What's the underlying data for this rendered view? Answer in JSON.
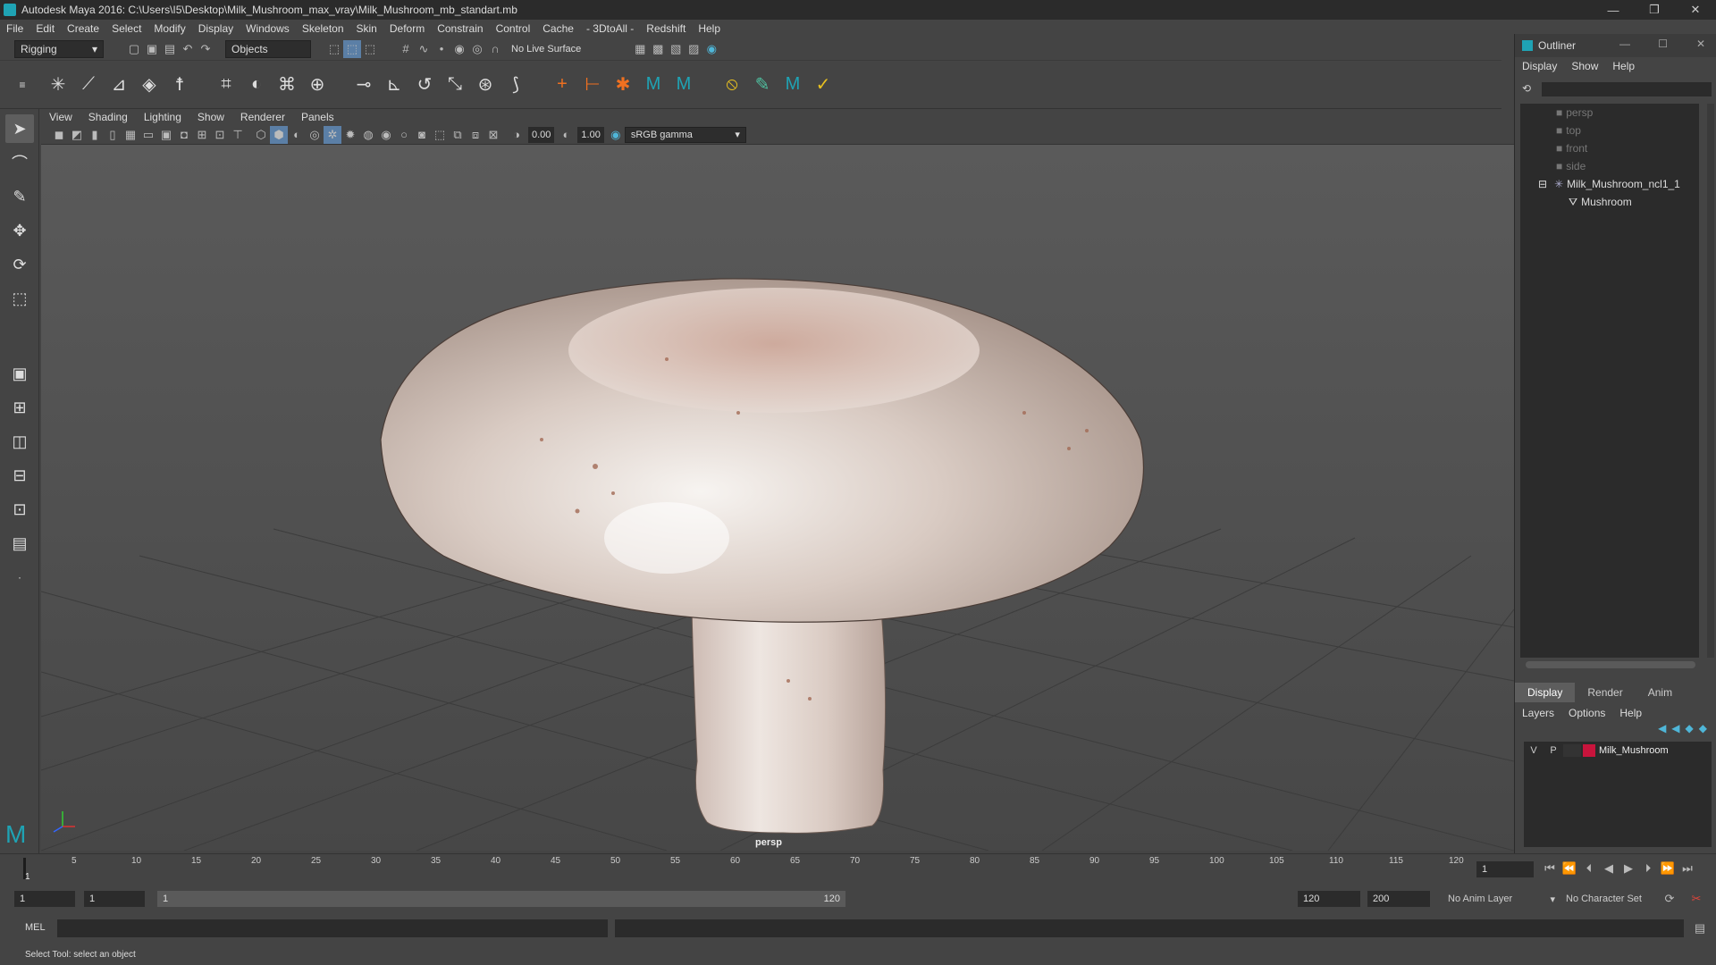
{
  "window": {
    "title": "Autodesk Maya 2016: C:\\Users\\I5\\Desktop\\Milk_Mushroom_max_vray\\Milk_Mushroom_mb_standart.mb",
    "minimize": "—",
    "restore": "❐",
    "close": "✕"
  },
  "menu": [
    "File",
    "Edit",
    "Create",
    "Select",
    "Modify",
    "Display",
    "Windows",
    "Skeleton",
    "Skin",
    "Deform",
    "Constrain",
    "Control",
    "Cache",
    "- 3DtoAll -",
    "Redshift",
    "Help"
  ],
  "shelf": {
    "mode": "Rigging",
    "selection_mask": "Objects",
    "live_surface": "No Live Surface"
  },
  "viewport": {
    "menu": [
      "View",
      "Shading",
      "Lighting",
      "Show",
      "Renderer",
      "Panels"
    ],
    "exposure": "0.00",
    "gamma": "1.00",
    "color_space": "sRGB gamma",
    "camera_label": "persp"
  },
  "outliner": {
    "title": "Outliner",
    "menu": [
      "Display",
      "Show",
      "Help"
    ],
    "items": [
      {
        "label": "persp",
        "type": "camera"
      },
      {
        "label": "top",
        "type": "camera"
      },
      {
        "label": "front",
        "type": "camera"
      },
      {
        "label": "side",
        "type": "camera"
      },
      {
        "label": "Milk_Mushroom_ncl1_1",
        "type": "group"
      },
      {
        "label": "Mushroom",
        "type": "mesh"
      }
    ]
  },
  "layers": {
    "tabs": [
      "Display",
      "Render",
      "Anim"
    ],
    "active_tab": "Display",
    "menu": [
      "Layers",
      "Options",
      "Help"
    ],
    "layer": {
      "v": "V",
      "p": "P",
      "name": "Milk_Mushroom",
      "color": "#c8143c"
    }
  },
  "timeline": {
    "ticks": [
      "5",
      "10",
      "15",
      "20",
      "25",
      "30",
      "35",
      "40",
      "45",
      "50",
      "55",
      "60",
      "65",
      "70",
      "75",
      "80",
      "85",
      "90",
      "95",
      "100",
      "105",
      "110",
      "115",
      "120"
    ],
    "current_frame": "1",
    "start_marker": "1"
  },
  "range": {
    "start": "1",
    "playback_start": "1",
    "slider_start": "1",
    "slider_end": "120",
    "playback_end": "120",
    "end": "200",
    "anim_layer": "No Anim Layer",
    "character_set": "No Character Set"
  },
  "command": {
    "label": "MEL"
  },
  "status": {
    "help": "Select Tool: select an object"
  }
}
